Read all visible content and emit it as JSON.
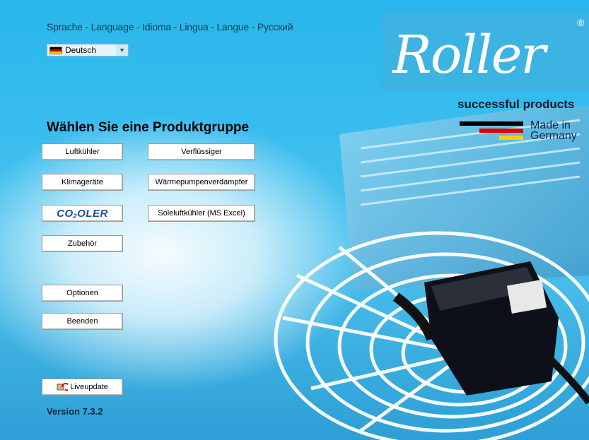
{
  "language": {
    "label": "Sprache - Language - Idioma - Lingua - Langue - Русский",
    "selected": "Deutsch",
    "flag_icon": "german-flag-icon"
  },
  "brand": {
    "logo": "Roller",
    "registered": "®",
    "tagline": "successful products",
    "made_in_line1": "Made in",
    "made_in_line2": "Germany"
  },
  "main": {
    "heading": "Wählen Sie eine Produktgruppe",
    "buttons": {
      "luftkuehler": "Luftkühler",
      "klimageraete": "Klimageräte",
      "cooler_main": "CO",
      "cooler_sub": "2",
      "cooler_rest": "OLER",
      "zubehoer": "Zubehör",
      "verfluessiger": "Verflüssiger",
      "waermepumpen": "Wärmepumpenverdampfer",
      "soleluft": "Soleluftkühler (MS Excel)",
      "optionen": "Optionen",
      "beenden": "Beenden",
      "liveupdate": "Liveupdate"
    }
  },
  "version": "Version 7.3.2",
  "colors": {
    "background": "#39bdee",
    "logo_box": "#3cb3e3",
    "german_flag": [
      "#000000",
      "#dd0000",
      "#ffce00"
    ]
  }
}
